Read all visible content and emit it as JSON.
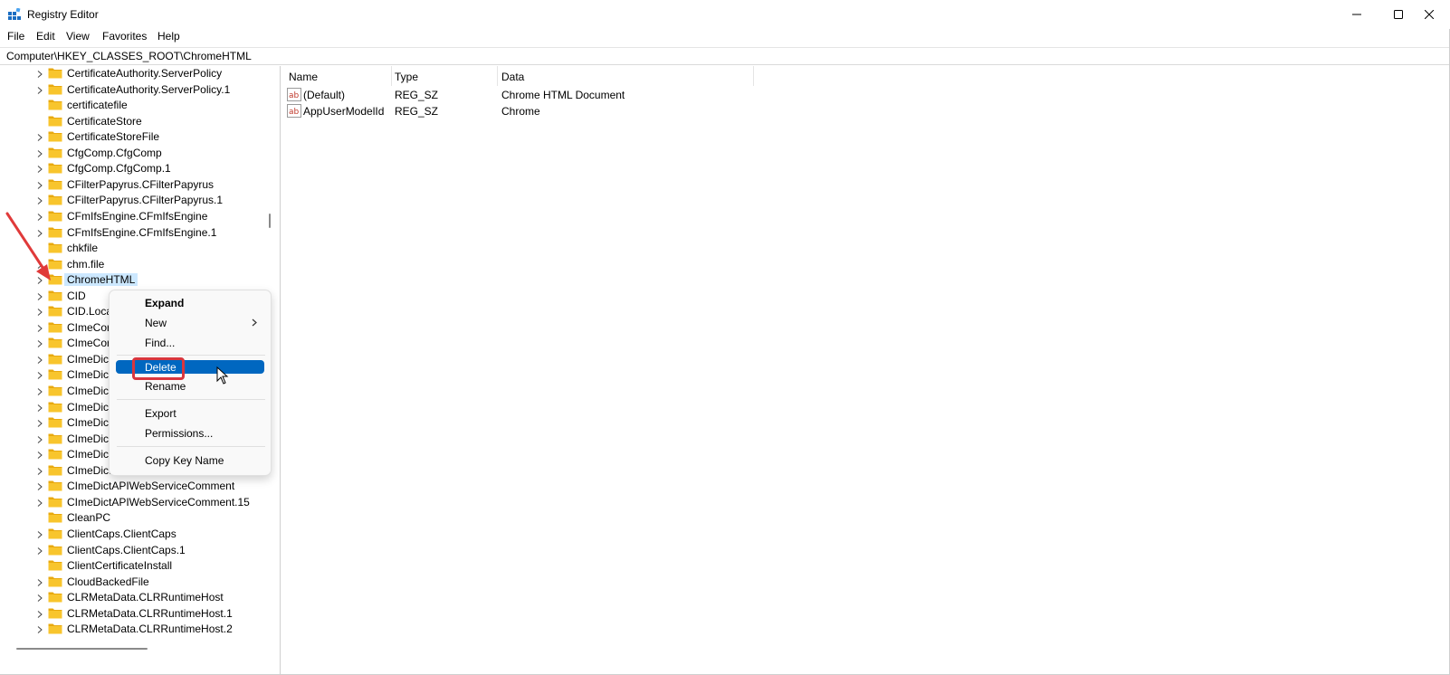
{
  "window": {
    "title": "Registry Editor",
    "app_icon": "registry-editor-icon",
    "controls": [
      "minimize-icon",
      "maximize-icon",
      "close-icon"
    ]
  },
  "menu": {
    "items": [
      "File",
      "Edit",
      "View",
      "Favorites",
      "Help"
    ]
  },
  "address": {
    "path": "Computer\\HKEY_CLASSES_ROOT\\ChromeHTML"
  },
  "tree": {
    "items": [
      {
        "label": "CertificateAuthority.ServerPolicy",
        "expandable": true
      },
      {
        "label": "CertificateAuthority.ServerPolicy.1",
        "expandable": true
      },
      {
        "label": "certificatefile",
        "expandable": false
      },
      {
        "label": "CertificateStore",
        "expandable": false
      },
      {
        "label": "CertificateStoreFile",
        "expandable": true
      },
      {
        "label": "CfgComp.CfgComp",
        "expandable": true
      },
      {
        "label": "CfgComp.CfgComp.1",
        "expandable": true
      },
      {
        "label": "CFilterPapyrus.CFilterPapyrus",
        "expandable": true
      },
      {
        "label": "CFilterPapyrus.CFilterPapyrus.1",
        "expandable": true
      },
      {
        "label": "CFmIfsEngine.CFmIfsEngine",
        "expandable": true
      },
      {
        "label": "CFmIfsEngine.CFmIfsEngine.1",
        "expandable": true
      },
      {
        "label": "chkfile",
        "expandable": false
      },
      {
        "label": "chm.file",
        "expandable": true
      },
      {
        "label": "ChromeHTML",
        "expandable": true,
        "selected": true
      },
      {
        "label": "CID",
        "expandable": true
      },
      {
        "label": "CID.Loca",
        "expandable": true
      },
      {
        "label": "CImeCor",
        "expandable": true
      },
      {
        "label": "CImeCor",
        "expandable": true
      },
      {
        "label": "CImeDict",
        "expandable": true
      },
      {
        "label": "CImeDict",
        "expandable": true
      },
      {
        "label": "CImeDict",
        "expandable": true
      },
      {
        "label": "CImeDict",
        "expandable": true
      },
      {
        "label": "CImeDict",
        "expandable": true
      },
      {
        "label": "CImeDict",
        "expandable": true
      },
      {
        "label": "CImeDict",
        "expandable": true
      },
      {
        "label": "CImeDictAPILocalWordComment.15",
        "expandable": true
      },
      {
        "label": "CImeDictAPIWebServiceComment",
        "expandable": true
      },
      {
        "label": "CImeDictAPIWebServiceComment.15",
        "expandable": true
      },
      {
        "label": "CleanPC",
        "expandable": false
      },
      {
        "label": "ClientCaps.ClientCaps",
        "expandable": true
      },
      {
        "label": "ClientCaps.ClientCaps.1",
        "expandable": true
      },
      {
        "label": "ClientCertificateInstall",
        "expandable": false
      },
      {
        "label": "CloudBackedFile",
        "expandable": true
      },
      {
        "label": "CLRMetaData.CLRRuntimeHost",
        "expandable": true
      },
      {
        "label": "CLRMetaData.CLRRuntimeHost.1",
        "expandable": true
      },
      {
        "label": "CLRMetaData.CLRRuntimeHost.2",
        "expandable": true
      }
    ]
  },
  "list": {
    "headers": {
      "name": "Name",
      "type": "Type",
      "data": "Data"
    },
    "rows": [
      {
        "name": "(Default)",
        "type": "REG_SZ",
        "data": "Chrome HTML Document"
      },
      {
        "name": "AppUserModelId",
        "type": "REG_SZ",
        "data": "Chrome"
      }
    ]
  },
  "context_menu": {
    "expand": "Expand",
    "new": "New",
    "find": "Find...",
    "delete": "Delete",
    "rename": "Rename",
    "export": "Export",
    "permissions": "Permissions...",
    "copy_key_name": "Copy Key Name"
  },
  "colors": {
    "selection": "#cce8ff",
    "menu_highlight": "#0067c0",
    "annotation_red": "#d9363e",
    "folder_yellow": "#f8c52d"
  }
}
